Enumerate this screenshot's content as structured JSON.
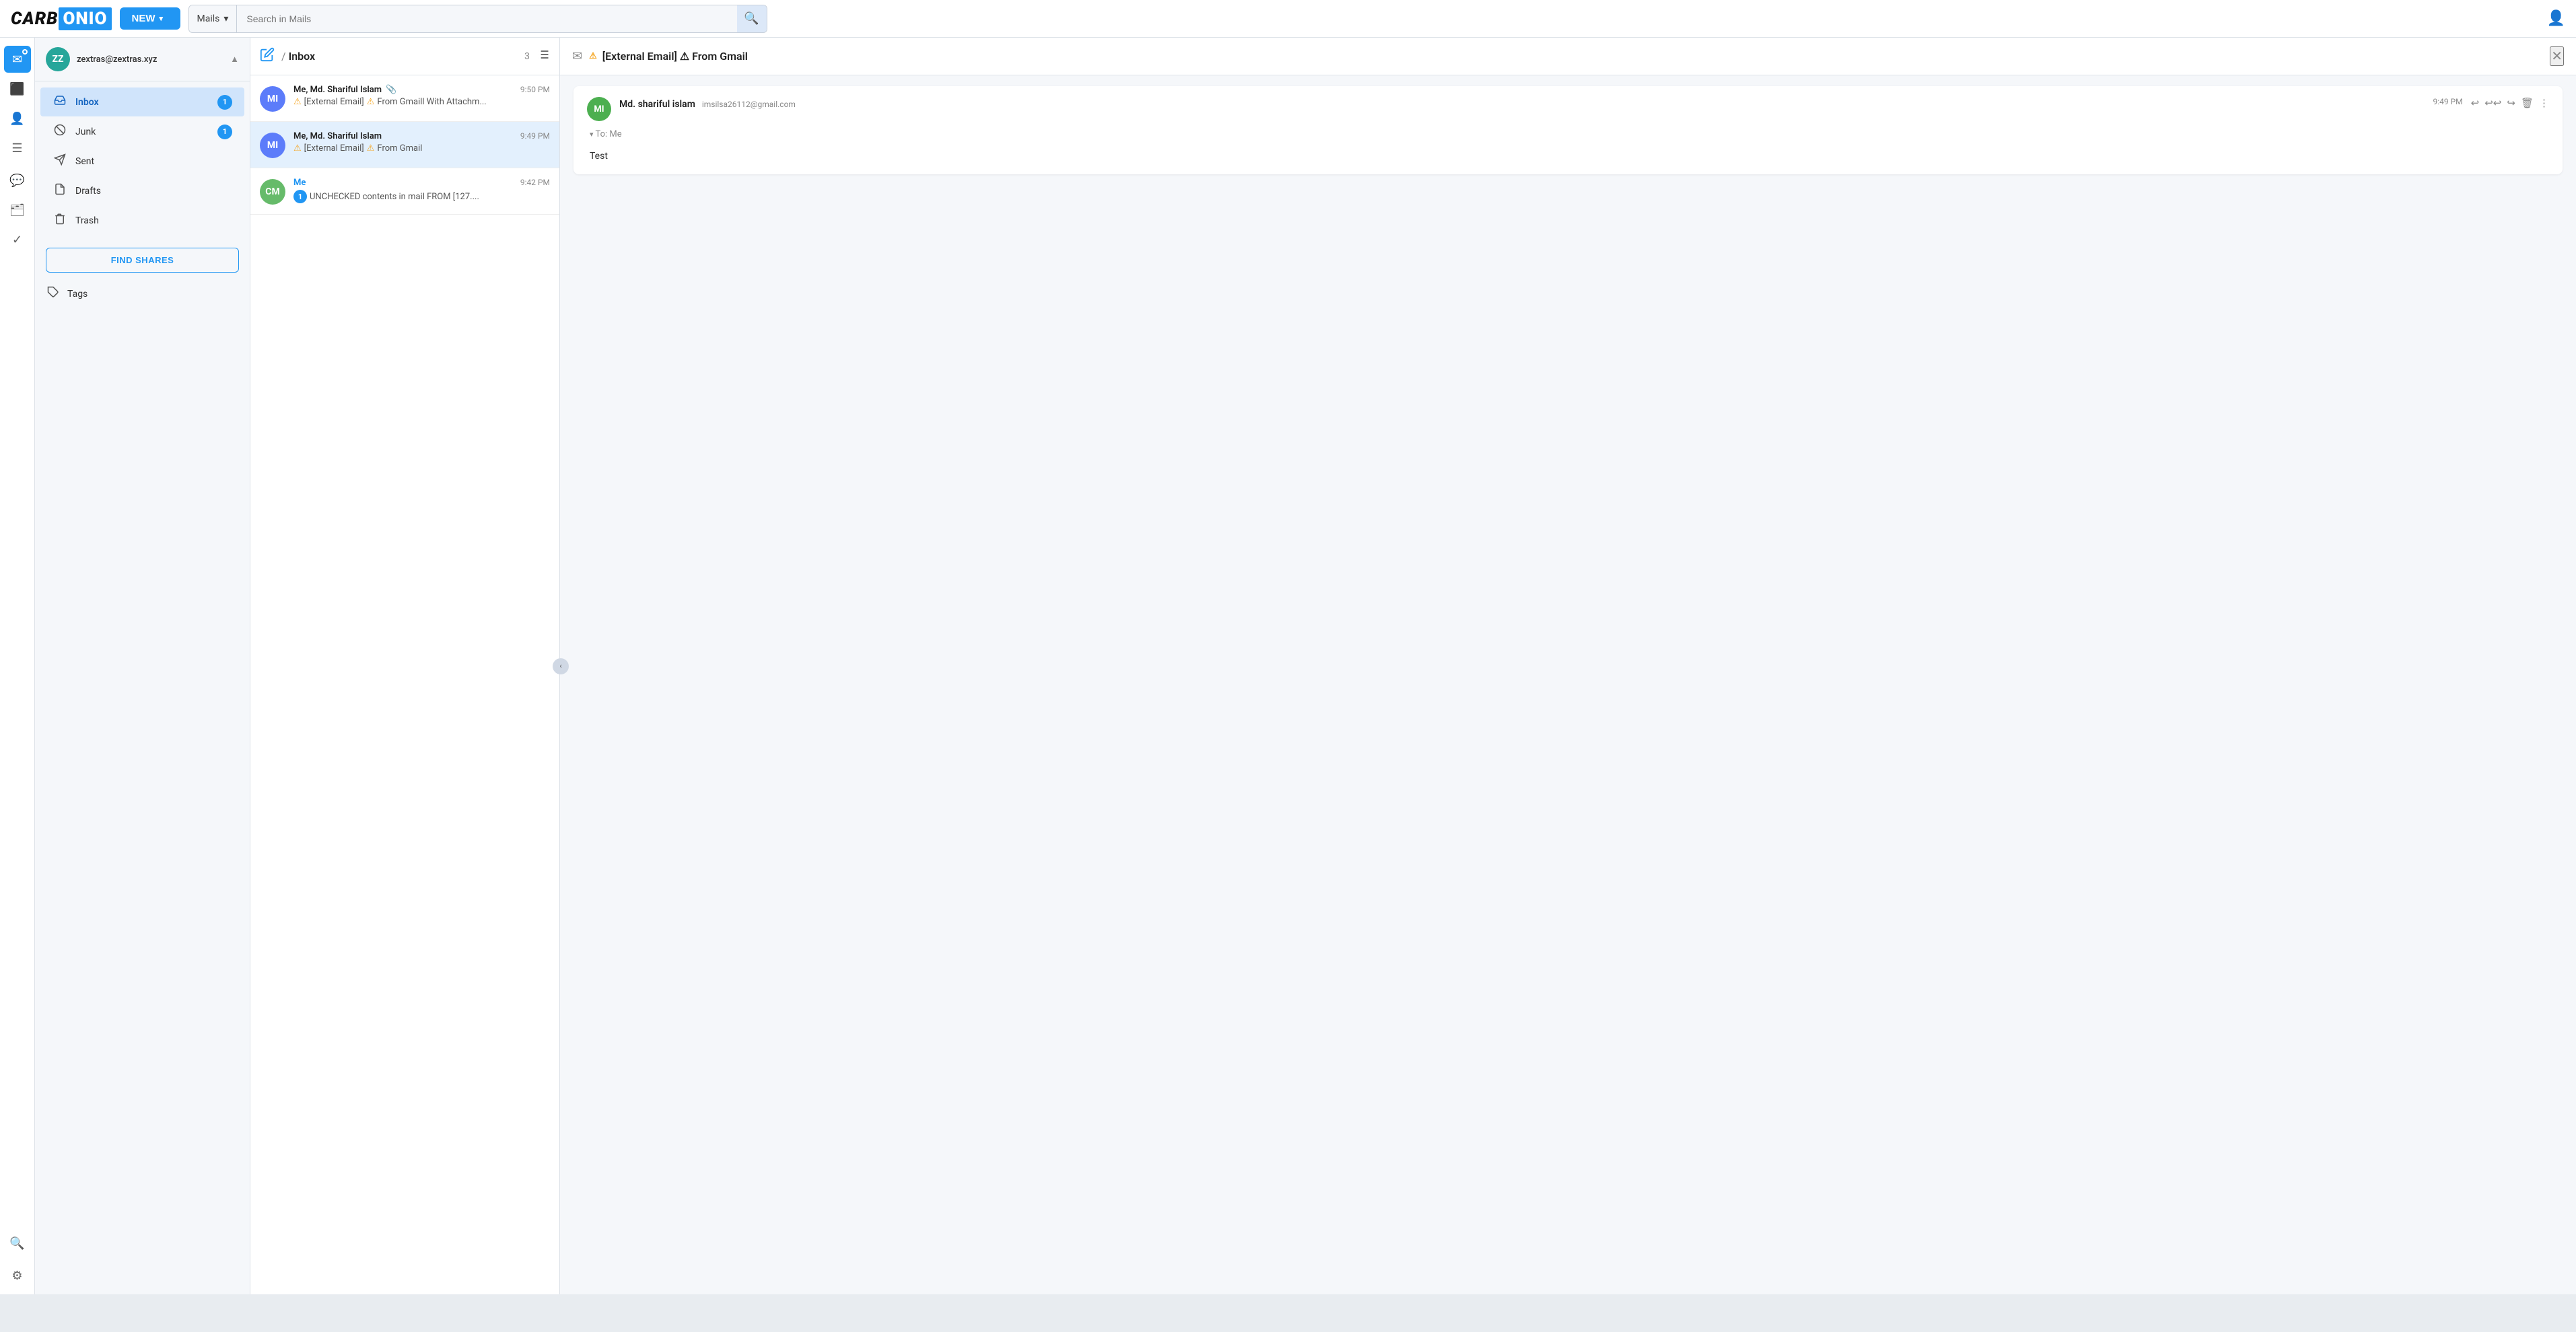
{
  "app": {
    "name": "CARBONIO",
    "name_part1": "CARB",
    "name_highlight": "ONIO"
  },
  "topbar": {
    "new_button": "NEW",
    "search_dropdown": "Mails",
    "search_placeholder": "Search in Mails",
    "search_chevron": "▾"
  },
  "icon_bar": {
    "items": [
      {
        "name": "mail-icon",
        "symbol": "✉",
        "active": true,
        "badge": true
      },
      {
        "name": "calendar-icon",
        "symbol": "📅",
        "active": false
      },
      {
        "name": "contacts-icon",
        "symbol": "👤",
        "active": false
      },
      {
        "name": "tasks-icon",
        "symbol": "☰",
        "active": false
      },
      {
        "name": "chat-icon",
        "symbol": "💬",
        "active": false
      },
      {
        "name": "files-icon",
        "symbol": "🗂",
        "active": false
      },
      {
        "name": "checkmark-icon",
        "symbol": "✓",
        "active": false
      },
      {
        "name": "search-nav-icon",
        "symbol": "🔍",
        "active": false
      },
      {
        "name": "settings-icon",
        "symbol": "⚙",
        "active": false
      }
    ]
  },
  "sidebar": {
    "user": {
      "initials": "ZZ",
      "email": "zextras@zextras.xyz",
      "avatar_color": "#26a69a"
    },
    "nav_items": [
      {
        "id": "inbox",
        "label": "Inbox",
        "icon": "📥",
        "active": true,
        "badge": 1
      },
      {
        "id": "junk",
        "label": "Junk",
        "icon": "🚫",
        "active": false,
        "badge": 1
      },
      {
        "id": "sent",
        "label": "Sent",
        "icon": "➤",
        "active": false,
        "badge": null
      },
      {
        "id": "drafts",
        "label": "Drafts",
        "icon": "📄",
        "active": false,
        "badge": null
      },
      {
        "id": "trash",
        "label": "Trash",
        "icon": "🗑",
        "active": false,
        "badge": null
      }
    ],
    "find_shares_label": "FIND SHARES",
    "tags_label": "Tags"
  },
  "mail_list": {
    "header": {
      "breadcrumb_sep": "/",
      "folder_name": "Inbox",
      "count": "3"
    },
    "emails": [
      {
        "id": "email1",
        "from": "Me, Md. Shariful Islam",
        "avatar_initials": "MI",
        "avatar_color": "#5c7cfa",
        "time": "9:50 PM",
        "has_attachment": true,
        "subject": "⚠[External Email] ⚠ From Gmaill With Attachm...",
        "selected": false
      },
      {
        "id": "email2",
        "from": "Me, Md. Shariful Islam",
        "avatar_initials": "MI",
        "avatar_color": "#5c7cfa",
        "time": "9:49 PM",
        "has_attachment": false,
        "subject": "⚠[External Email] ⚠ From Gmail",
        "selected": true
      },
      {
        "id": "email3",
        "from": "Me",
        "avatar_initials": "CM",
        "avatar_color": "#66bb6a",
        "time": "9:42 PM",
        "has_attachment": false,
        "subject": "UNCHECKED contents in mail FROM [127....",
        "unread_count": 1,
        "selected": false
      }
    ]
  },
  "reading_pane": {
    "header": {
      "warning_prefix": "⚠",
      "subject": "[External Email] ⚠ From Gmail"
    },
    "email": {
      "sender_name": "Md. shariful islam",
      "sender_email": "imsilsa26112@gmail.com",
      "sender_initials": "MI",
      "sender_avatar_color": "#66bb6a",
      "time": "9:49 PM",
      "to": "To:  Me",
      "body": "Test"
    }
  }
}
